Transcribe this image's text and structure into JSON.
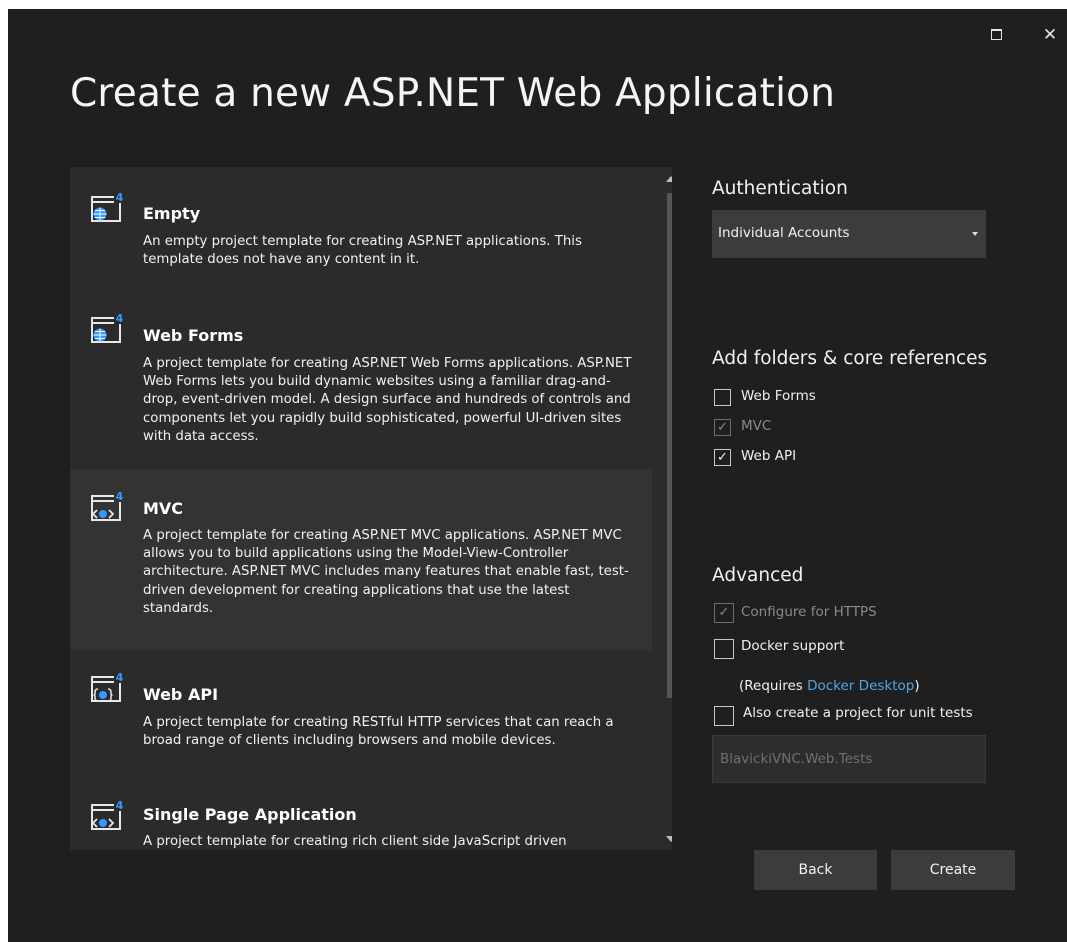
{
  "window": {
    "title": "Create a new ASP.NET Web Application",
    "maximize_glyph": "",
    "close_glyph": "✕"
  },
  "templates": [
    {
      "name": "Empty",
      "description": "An empty project template for creating ASP.NET applications. This template does not have any content in it.",
      "icon": "web-globe-icon",
      "selected": false
    },
    {
      "name": "Web Forms",
      "description": "A project template for creating ASP.NET Web Forms applications. ASP.NET Web Forms lets you build dynamic websites using a familiar drag-and-drop, event-driven model. A design surface and hundreds of controls and components let you rapidly build sophisticated, powerful UI-driven sites with data access.",
      "icon": "web-globe-icon",
      "selected": false
    },
    {
      "name": "MVC",
      "description": "A project template for creating ASP.NET MVC applications. ASP.NET MVC allows you to build applications using the Model-View-Controller architecture. ASP.NET MVC includes many features that enable fast, test-driven development for creating applications that use the latest standards.",
      "icon": "web-code-icon",
      "selected": true
    },
    {
      "name": "Web API",
      "description": "A project template for creating RESTful HTTP services that can reach a broad range of clients including browsers and mobile devices.",
      "icon": "web-api-icon",
      "selected": false
    },
    {
      "name": "Single Page Application",
      "description": "A project template for creating rich client side JavaScript driven",
      "icon": "web-code-icon",
      "selected": false
    }
  ],
  "authentication": {
    "heading": "Authentication",
    "selected": "Individual Accounts"
  },
  "folders": {
    "heading": "Add folders & core references",
    "items": [
      {
        "label": "Web Forms",
        "checked": false,
        "disabled": false
      },
      {
        "label": "MVC",
        "checked": true,
        "disabled": true
      },
      {
        "label": "Web API",
        "checked": true,
        "disabled": false
      }
    ]
  },
  "advanced": {
    "heading": "Advanced",
    "https_label": "Configure for HTTPS",
    "docker_label": "Docker support",
    "docker_note_prefix": "(Requires ",
    "docker_link": "Docker Desktop",
    "docker_note_suffix": ")",
    "unit_tests_label": "Also create a project for unit tests",
    "test_project_name": "BlavickiVNC.Web.Tests"
  },
  "buttons": {
    "back": "Back",
    "create": "Create"
  },
  "colors": {
    "background": "#1f1f1f",
    "panel": "#2b2b2b",
    "selected": "#333333",
    "accent_link": "#4ea6ea",
    "badge": "#3399ff"
  }
}
